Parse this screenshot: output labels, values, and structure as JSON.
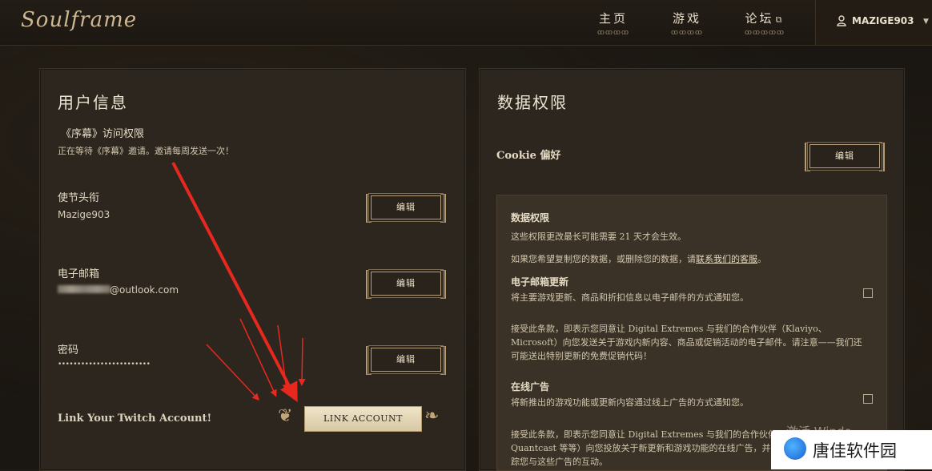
{
  "header": {
    "logo": "Soulframe",
    "nav": [
      {
        "label": "主页",
        "sub": "ꝏꝏꝏꝏ"
      },
      {
        "label": "游戏",
        "sub": "ꝏꝏꝏꝏ"
      },
      {
        "label": "论坛",
        "sub": "ꝏꝏꝏꝏꝏ",
        "external": "⧉"
      }
    ],
    "username": "MAZIGE903",
    "caret": "▼"
  },
  "user_info": {
    "title": "用户信息",
    "prologue_title": "《序幕》访问权限",
    "prologue_desc": "正在等待《序幕》邀请。邀请每周发送一次！",
    "envoy_label": "使节头衔",
    "envoy_value": "Mazige903",
    "email_label": "电子邮箱",
    "email_value": "@outlook.com",
    "password_label": "密码",
    "password_value": "••••••••••••••••••••••••",
    "edit_label": "编辑",
    "twitch_label": "Link Your Twitch Account!",
    "link_button": "LINK ACCOUNT"
  },
  "data_permissions": {
    "title": "数据权限",
    "cookie_label": "Cookie 偏好",
    "edit_label": "编辑",
    "box_title": "数据权限",
    "box_desc1": "这些权限更改最长可能需要 21 天才会生效。",
    "box_desc2_pre": "如果您希望复制您的数据，或删除您的数据，请",
    "box_desc2_link": "联系我们的客服",
    "box_desc2_post": "。",
    "email_updates_title": "电子邮箱更新",
    "email_updates_desc": "将主要游戏更新、商品和折扣信息以电子邮件的方式通知您。",
    "email_terms_1": "接受此条款，即表示您同意让 Digital Extremes 与我们的合作伙伴（Klaviyo、",
    "email_terms_2": "Microsoft）向您发送关于游戏内新内容、商品或促销活动的电子邮件。请注意——我们还",
    "email_terms_3": "可能送出特别更新的免费促销代码！",
    "ads_title": "在线广告",
    "ads_desc": "将新推出的游戏功能或更新内容通过线上广告的方式通知您。",
    "ads_terms_1": "接受此条款，即表示您同意让 Digital Extremes 与我们的合作伙伴",
    "ads_terms_2": "Quantcast 等等）向您投放关于新更新和游戏功能的在线广告，并",
    "ads_terms_3": "踪您与这些广告的互动。"
  },
  "watermark": {
    "text": "唐佳软件园",
    "ghost": "激活 Windo"
  },
  "colors": {
    "background": "#1a1611",
    "panel": "#2c261e",
    "accent_gold": "#b8a07a",
    "arrow_red": "#e8281e"
  }
}
